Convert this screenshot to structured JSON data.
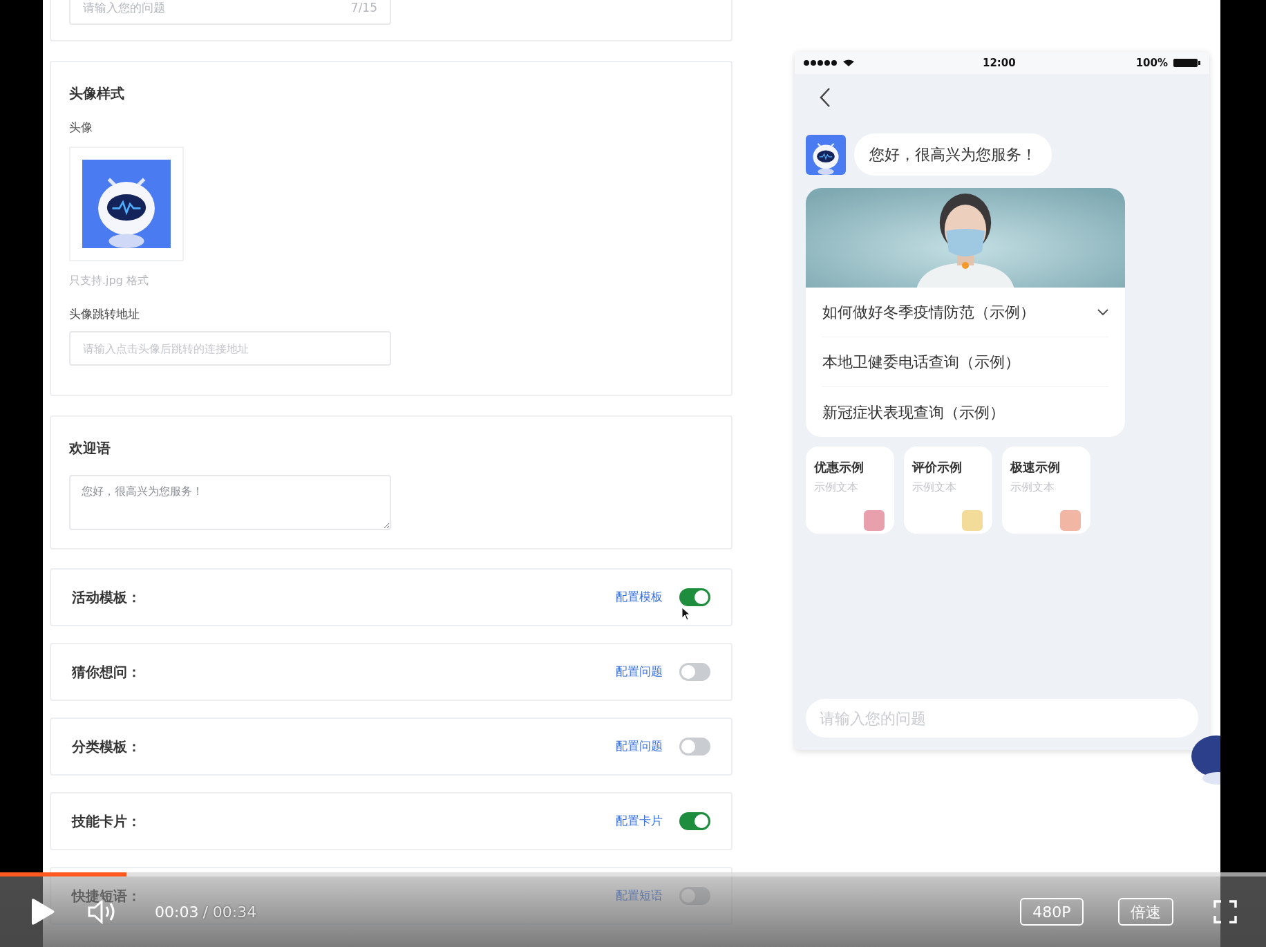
{
  "top_field": {
    "placeholder": "请输入您的问题",
    "counter": "7/15"
  },
  "avatar_section": {
    "title": "头像样式",
    "avatar_label": "头像",
    "hint": "只支持.jpg 格式",
    "link_label": "头像跳转地址",
    "link_placeholder": "请输入点击头像后跳转的连接地址"
  },
  "welcome": {
    "title": "欢迎语",
    "value": "您好，很高兴为您服务！"
  },
  "features": [
    {
      "label": "活动模板：",
      "link": "配置模板",
      "on": true
    },
    {
      "label": "猜你想问：",
      "link": "配置问题",
      "on": false
    },
    {
      "label": "分类模板：",
      "link": "配置问题",
      "on": false
    },
    {
      "label": "技能卡片：",
      "link": "配置卡片",
      "on": true
    },
    {
      "label": "快捷短语：",
      "link": "配置短语",
      "on": false
    }
  ],
  "phone": {
    "status": {
      "time": "12:00",
      "battery": "100%"
    },
    "greeting": "您好，很高兴为您服务！",
    "questions": [
      {
        "text": "如何做好冬季疫情防范（示例）",
        "expandable": true
      },
      {
        "text": "本地卫健委电话查询（示例）",
        "expandable": false
      },
      {
        "text": "新冠症状表现查询（示例）",
        "expandable": false
      }
    ],
    "cards": [
      {
        "title": "优惠示例",
        "subtitle": "示例文本",
        "color": "#e8a0ad"
      },
      {
        "title": "评价示例",
        "subtitle": "示例文本",
        "color": "#f3dc9a"
      },
      {
        "title": "极速示例",
        "subtitle": "示例文本",
        "color": "#f1b7a4"
      }
    ],
    "input_placeholder": "请输入您的问题"
  },
  "player": {
    "level": 0.1,
    "current": "00:03",
    "total": "/ 00:34",
    "quality": "480P",
    "speed": "倍速"
  }
}
